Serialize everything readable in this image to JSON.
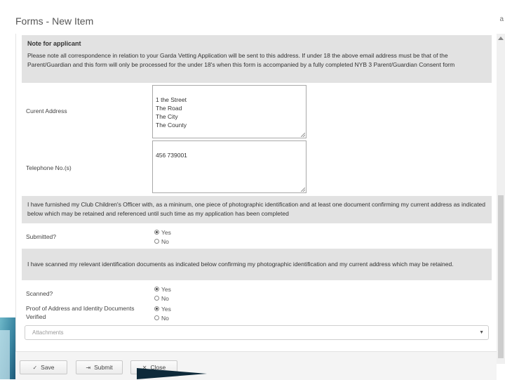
{
  "window": {
    "title": "Forms - New Item",
    "corner_glyph": "a"
  },
  "note": {
    "title": "Note for applicant",
    "text": "Please note all correspondence in relation to your Garda Vetting Application will be sent to this address. If under 18 the above email address must be that of the Parent/Guardian and this form will only be processed for the under 18's when this form is accompanied by a fully completed NYB 3 Parent/Guardian Consent form"
  },
  "address": {
    "label": "Curent Address",
    "value": "1 the Street\nThe Road\nThe City\nThe County"
  },
  "phone": {
    "label": "Telephone No.(s)",
    "value": "456 739001"
  },
  "furnished_band": "I have furnished my Club Children's Officer with, as a mininum, one piece of photographic identification and at least one document confirming my current address as indicated below which may be retained and referenced until such time as my application has been completed",
  "submitted": {
    "label": "Submitted?",
    "options": [
      "Yes",
      "No"
    ],
    "selected": "Yes"
  },
  "scanned_band": "I have scanned my relevant identification documents as indicated below confirming my photographic identification and my current address which may be retained.",
  "scanned": {
    "label": "Scanned?",
    "options": [
      "Yes",
      "No"
    ],
    "selected": "Yes"
  },
  "proof": {
    "label_line1": "Proof of Address and Identity Documents",
    "label_line2": "Verified",
    "options": [
      "Yes",
      "No"
    ],
    "selected": "Yes"
  },
  "attachments": {
    "placeholder": "Attachments"
  },
  "footer": {
    "save": "Save",
    "submit": "Submit",
    "close": "Close"
  },
  "colors": {
    "band_grey": "#e2e2e2",
    "footer_bg": "#f4f4f4",
    "accent_blue": "#3a86a2"
  }
}
